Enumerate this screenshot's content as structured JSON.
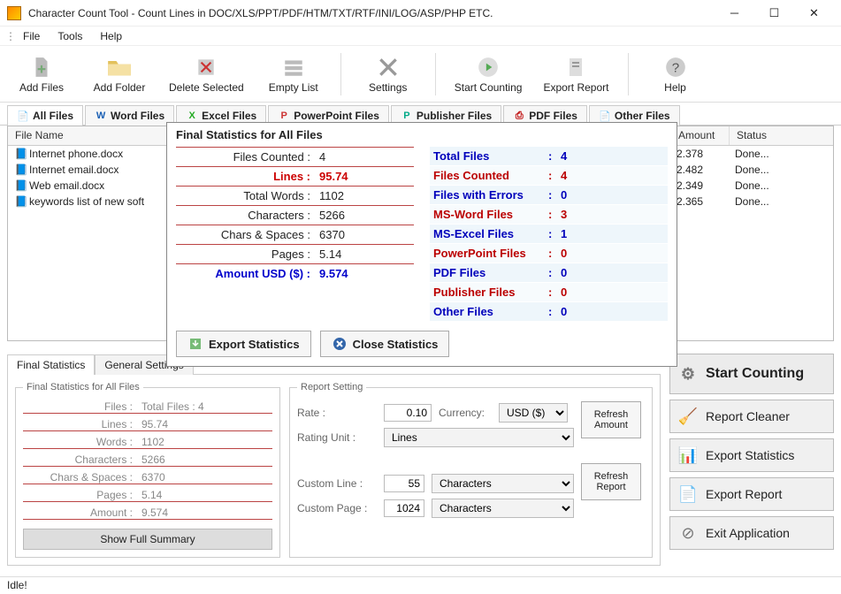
{
  "window": {
    "title": "Character Count Tool - Count Lines in DOC/XLS/PPT/PDF/HTM/TXT/RTF/INI/LOG/ASP/PHP ETC."
  },
  "menu": {
    "file": "File",
    "tools": "Tools",
    "help": "Help"
  },
  "toolbar": {
    "add_files": "Add Files",
    "add_folder": "Add Folder",
    "delete_selected": "Delete Selected",
    "empty_list": "Empty List",
    "settings": "Settings",
    "start_counting": "Start Counting",
    "export_report": "Export Report",
    "help": "Help"
  },
  "typetabs": {
    "all": "All Files",
    "word": "Word Files",
    "excel": "Excel Files",
    "ppt": "PowerPoint Files",
    "pub": "Publisher Files",
    "pdf": "PDF Files",
    "other": "Other Files"
  },
  "columns": {
    "file_name": "File Name",
    "amount": "Amount",
    "status": "Status"
  },
  "files": [
    {
      "name": "Internet phone.docx",
      "amount": "2.378",
      "status": "Done..."
    },
    {
      "name": "Internet email.docx",
      "amount": "2.482",
      "status": "Done..."
    },
    {
      "name": "Web email.docx",
      "amount": "2.349",
      "status": "Done..."
    },
    {
      "name": "keywords list of new soft",
      "amount": "2.365",
      "status": "Done..."
    }
  ],
  "stats_modal": {
    "title": "Final Statistics for All Files",
    "left": [
      {
        "k": "Files Counted :",
        "v": "4",
        "cls": ""
      },
      {
        "k": "Lines :",
        "v": "95.74",
        "cls": "red"
      },
      {
        "k": "Total Words :",
        "v": "1102",
        "cls": ""
      },
      {
        "k": "Characters :",
        "v": "5266",
        "cls": ""
      },
      {
        "k": "Chars & Spaces :",
        "v": "6370",
        "cls": ""
      },
      {
        "k": "Pages :",
        "v": "5.14",
        "cls": ""
      },
      {
        "k": "Amount USD ($) :",
        "v": "9.574",
        "cls": "blue"
      }
    ],
    "right": [
      {
        "k": "Total Files",
        "v": "4",
        "cls": "blue"
      },
      {
        "k": "Files Counted",
        "v": "4",
        "cls": "redd"
      },
      {
        "k": "Files with Errors",
        "v": "0",
        "cls": "blue"
      },
      {
        "k": "MS-Word Files",
        "v": "3",
        "cls": "redd"
      },
      {
        "k": "MS-Excel Files",
        "v": "1",
        "cls": "blue"
      },
      {
        "k": "PowerPoint Files",
        "v": "0",
        "cls": "redd"
      },
      {
        "k": "PDF Files",
        "v": "0",
        "cls": "blue"
      },
      {
        "k": "Publisher Files",
        "v": "0",
        "cls": "redd"
      },
      {
        "k": "Other Files",
        "v": "0",
        "cls": "blue"
      }
    ],
    "export_btn": "Export Statistics",
    "close_btn": "Close Statistics"
  },
  "bottom_tabs": {
    "final": "Final Statistics",
    "general": "General Settings"
  },
  "final_stats_group": {
    "legend": "Final Statistics for All Files",
    "rows": [
      {
        "k": "Files :",
        "v": "Total Files : 4"
      },
      {
        "k": "Lines :",
        "v": "95.74"
      },
      {
        "k": "Words :",
        "v": "1102"
      },
      {
        "k": "Characters :",
        "v": "5266"
      },
      {
        "k": "Chars & Spaces :",
        "v": "6370"
      },
      {
        "k": "Pages :",
        "v": "5.14"
      },
      {
        "k": "Amount :",
        "v": "9.574"
      }
    ],
    "show_full": "Show Full Summary"
  },
  "report_setting": {
    "legend": "Report Setting",
    "rate_lbl": "Rate :",
    "rate_val": "0.10",
    "currency_lbl": "Currency:",
    "currency_val": "USD ($)",
    "rating_unit_lbl": "Rating Unit :",
    "rating_unit_val": "Lines",
    "custom_line_lbl": "Custom Line :",
    "custom_line_val": "55",
    "custom_line_unit": "Characters",
    "custom_page_lbl": "Custom Page :",
    "custom_page_val": "1024",
    "custom_page_unit": "Characters",
    "refresh_amount": "Refresh Amount",
    "refresh_report": "Refresh Report"
  },
  "actions": {
    "start": "Start Counting",
    "cleaner": "Report Cleaner",
    "export_stats": "Export Statistics",
    "export_report": "Export Report",
    "exit": "Exit Application"
  },
  "status": "Idle!"
}
